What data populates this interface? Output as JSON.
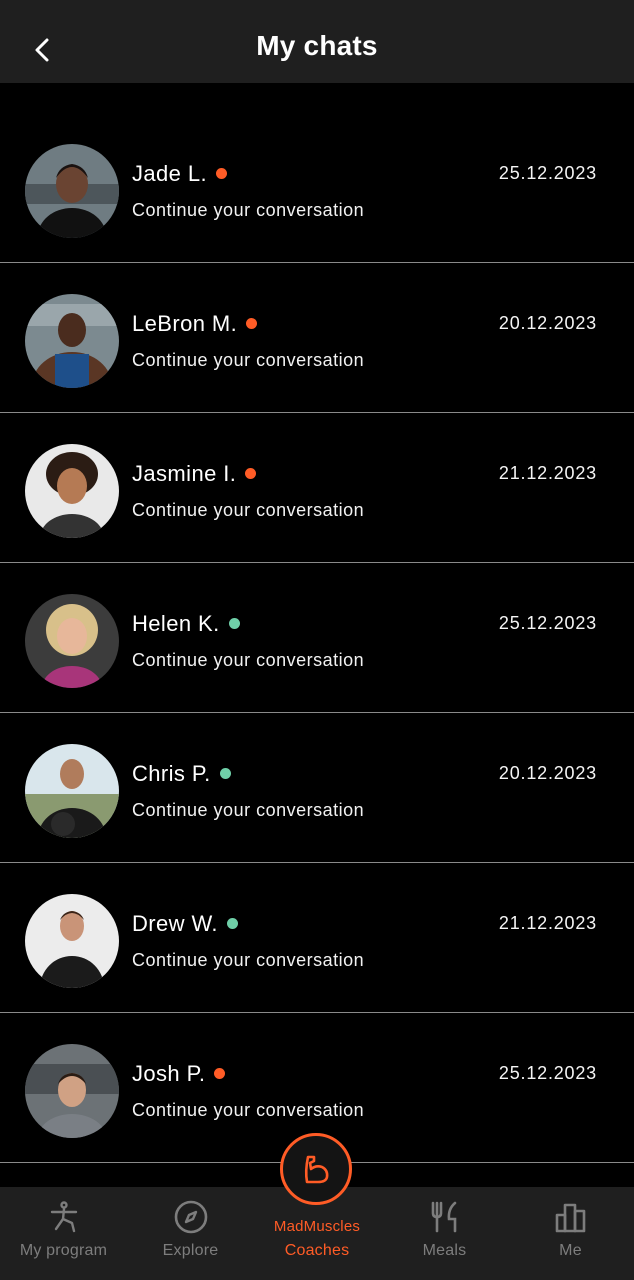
{
  "header": {
    "title": "My chats"
  },
  "colors": {
    "accent": "#ff5c26",
    "online": "#6fcfa8",
    "offline": "#ff5c26"
  },
  "chats": [
    {
      "name": "Jade L.",
      "status": "offline",
      "subtitle": "Continue your conversation",
      "date": "25.12.2023"
    },
    {
      "name": "LeBron M.",
      "status": "offline",
      "subtitle": "Continue your conversation",
      "date": "20.12.2023"
    },
    {
      "name": "Jasmine I.",
      "status": "offline",
      "subtitle": "Continue your conversation",
      "date": "21.12.2023"
    },
    {
      "name": "Helen K.",
      "status": "online",
      "subtitle": "Continue your conversation",
      "date": "25.12.2023"
    },
    {
      "name": "Chris P.",
      "status": "online",
      "subtitle": "Continue your conversation",
      "date": "20.12.2023"
    },
    {
      "name": "Drew W.",
      "status": "online",
      "subtitle": "Continue your conversation",
      "date": "21.12.2023"
    },
    {
      "name": "Josh P.",
      "status": "offline",
      "subtitle": "Continue your conversation",
      "date": "25.12.2023"
    }
  ],
  "tabbar": {
    "my_program": "My program",
    "explore": "Explore",
    "coaches_brand": "MadMuscles",
    "coaches": "Coaches",
    "meals": "Meals",
    "me": "Me"
  }
}
